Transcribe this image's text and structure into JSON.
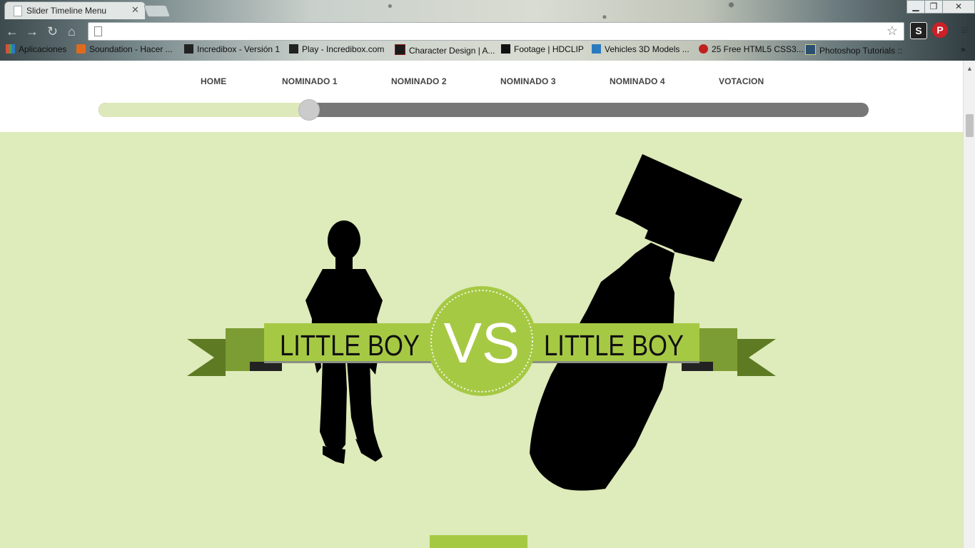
{
  "browser": {
    "tab_title": "Slider Timeline Menu",
    "tab_close": "✕",
    "address": "",
    "window_controls": {
      "minimize": "▁",
      "restore": "❐",
      "close": "✕"
    },
    "nav_icons": [
      "back-icon",
      "forward-icon",
      "reload-icon",
      "home-icon"
    ],
    "bookmarks": [
      {
        "label": "Aplicaciones",
        "icon": "apps-grid-icon",
        "color": "#e14b3b"
      },
      {
        "label": "Soundation - Hacer ...",
        "icon": "soundation-icon",
        "color": "#e06a1b"
      },
      {
        "label": "Incredibox - Versión 1",
        "icon": "incredibox-icon",
        "color": "#222222"
      },
      {
        "label": "Play - Incredibox.com",
        "icon": "incredibox-icon",
        "color": "#222222"
      },
      {
        "label": "Character Design | A...",
        "icon": "cd-icon",
        "color": "#8a1d1d"
      },
      {
        "label": "Footage | HDCLIP",
        "icon": "hdclip-icon",
        "color": "#111111"
      },
      {
        "label": "Vehicles 3D Models ...",
        "icon": "3d-icon",
        "color": "#2a7ac0"
      },
      {
        "label": "25 Free HTML5 CSS3...",
        "icon": "html5-icon",
        "color": "#c02020"
      },
      {
        "label": "Photoshop Tutorials ::",
        "icon": "photoshop-icon",
        "color": "#2b4f6e"
      }
    ],
    "bookmarks_overflow": "»"
  },
  "nav": {
    "items": [
      "HOME",
      "NOMINADO 1",
      "NOMINADO 2",
      "NOMINADO 3",
      "NOMINADO 4",
      "VOTACION"
    ],
    "slider_progress": 0.273
  },
  "hero": {
    "left_label": "LITTLE BOY",
    "vs_label": "VS",
    "right_label": "LITTLE BOY",
    "colors": {
      "background": "#deebba",
      "banner": "#a6c944",
      "banner_dark": "#6f8f2b",
      "silhouette": "#000000"
    }
  }
}
